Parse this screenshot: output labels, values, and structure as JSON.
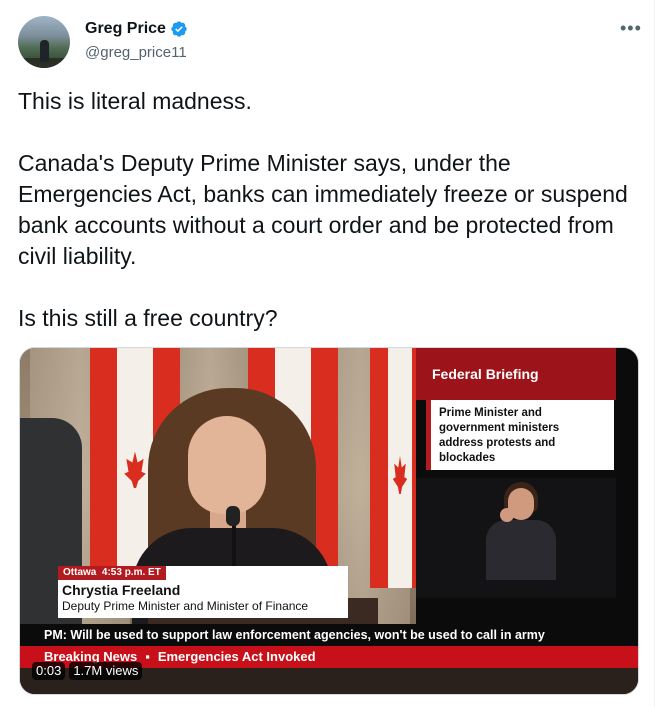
{
  "author": {
    "name": "Greg Price",
    "handle": "@greg_price11",
    "verified": true
  },
  "menu_icon": "more-horizontal-icon",
  "tweet": {
    "text": "This is literal madness.\n\nCanada's Deputy Prime Minister says, under the Emergencies Act, banks can immediately freeze or suspend bank accounts without a court order and be protected from civil liability.\n\nIs this still a free country?"
  },
  "video": {
    "panel_title": "Federal Briefing",
    "panel_text": "Prime Minister and government ministers address protests and blockades",
    "lower_third": {
      "location": "Ottawa",
      "time": "4:53 p.m. ET",
      "name": "Chrystia Freeland",
      "title": "Deputy Prime Minister and Minister of Finance"
    },
    "ticker": "PM: Will be used to support law enforcement agencies, won't be used to call in army",
    "breaking_label": "Breaking News",
    "breaking_separator": "▪",
    "breaking_text": "Emergencies Act Invoked",
    "elapsed": "0:03",
    "views": "1.7M views"
  },
  "colors": {
    "verified_blue": "#1d9bf0",
    "cbc_red": "#b21b20",
    "secondary_text": "#536471"
  }
}
